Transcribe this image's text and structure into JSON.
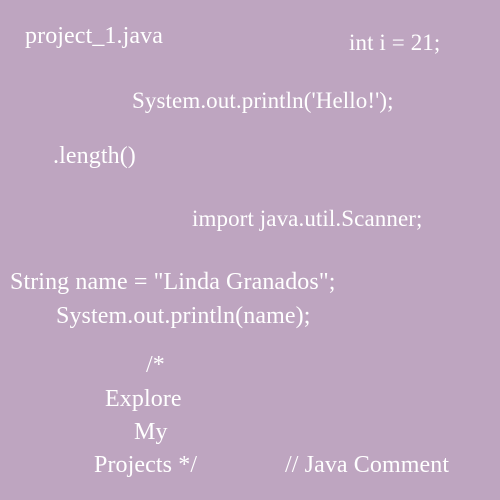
{
  "background_color": "#bea5c0",
  "text_color": "#ffffff",
  "snippets": {
    "filename": "project_1.java",
    "int_decl": "int i = 21;",
    "println_hello": "System.out.println('Hello!');",
    "length_call": ".length()",
    "import_stmt": "import java.util.Scanner;",
    "string_decl": "String name = \"Linda Granados\";",
    "println_name": "System.out.println(name);",
    "block_comment": {
      "open": "/*",
      "line1": "Explore",
      "line2": "My",
      "line3": "Projects */"
    },
    "line_comment": "// Java Comment"
  }
}
